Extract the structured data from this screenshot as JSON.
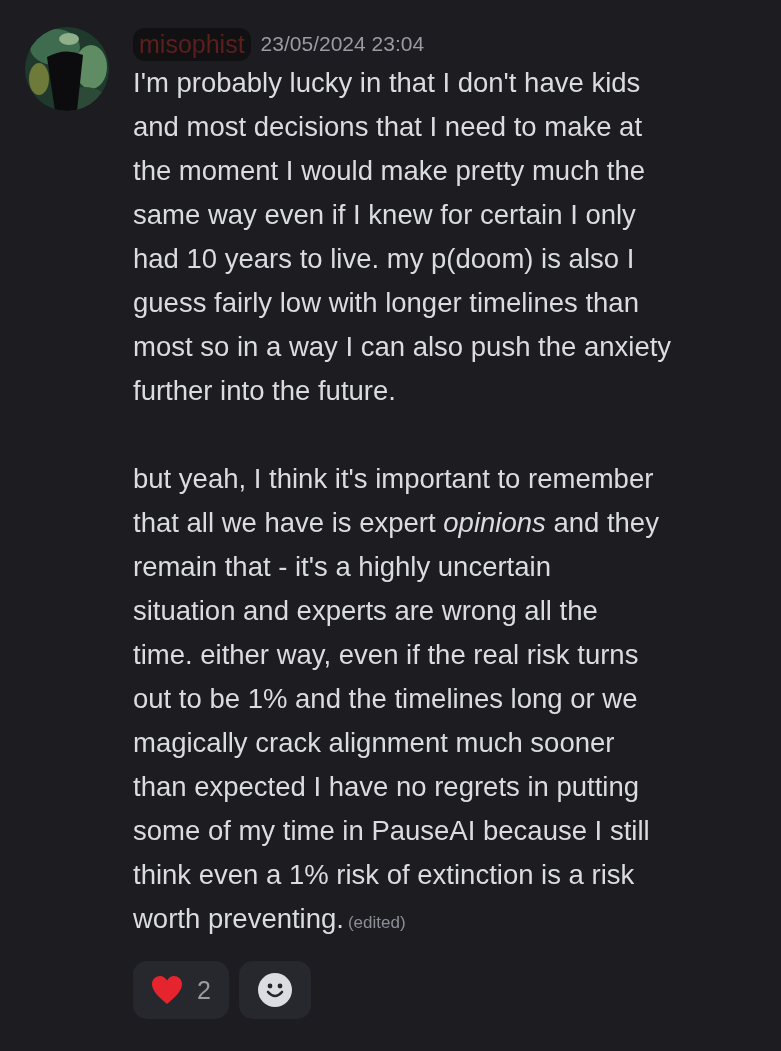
{
  "message": {
    "author": "misophist",
    "author_redacted": true,
    "timestamp": "23/05/2024 23:04",
    "paragraphs": [
      "I'm probably lucky in that I don't have kids\nand most decisions that I need to make at\nthe moment I would make pretty much the\nsame way even if I knew for certain I only\nhad 10 years to live. my p(doom) is also I\nguess fairly low with longer timelines than\nmost so in a way I can also push the anxiety\nfurther into the future.",
      "but yeah, I think it's important to remember\nthat all we have is expert *opinions* and they\nremain that - it's a highly uncertain\nsituation and experts  are wrong all the\ntime. either way, even if the real risk turns\nout to  be 1% and the timelines long or we\nmagically crack alignment much sooner\nthan expected I have no regrets in putting\nsome of my time in PauseAI because I still\nthink even a 1% risk of extinction is a risk\nworth preventing."
    ],
    "edited": "(edited)",
    "reactions": [
      {
        "kind": "heart",
        "count": "2",
        "selected": false
      },
      {
        "kind": "add"
      }
    ]
  }
}
